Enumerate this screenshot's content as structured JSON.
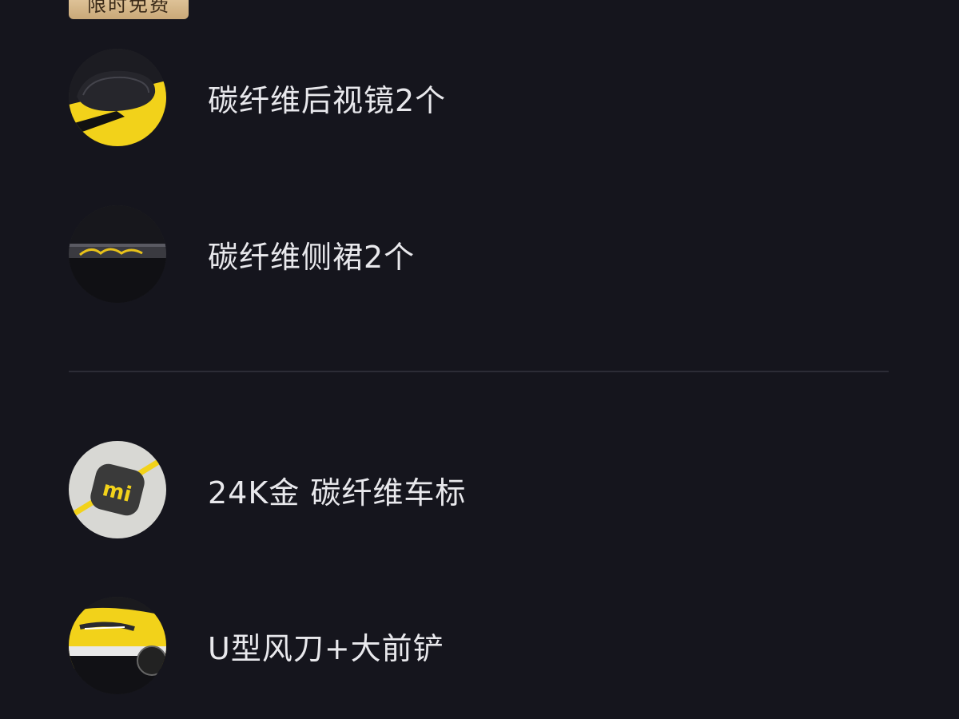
{
  "badge": {
    "label": "限时免费"
  },
  "items": [
    {
      "label": "碳纤维后视镜2个",
      "icon": "carbon-mirror-image"
    },
    {
      "label": "碳纤维侧裙2个",
      "icon": "carbon-side-skirt-image"
    },
    {
      "label": "24K金 碳纤维车标",
      "icon": "gold-carbon-logo-image"
    },
    {
      "label": "U型风刀+大前铲",
      "icon": "front-splitter-image"
    }
  ],
  "colors": {
    "background": "#15151d",
    "text": "#e8e8ec",
    "badge": "#d9bc8e",
    "accent_yellow": "#f2d21a",
    "divider": "#2c2c36"
  }
}
